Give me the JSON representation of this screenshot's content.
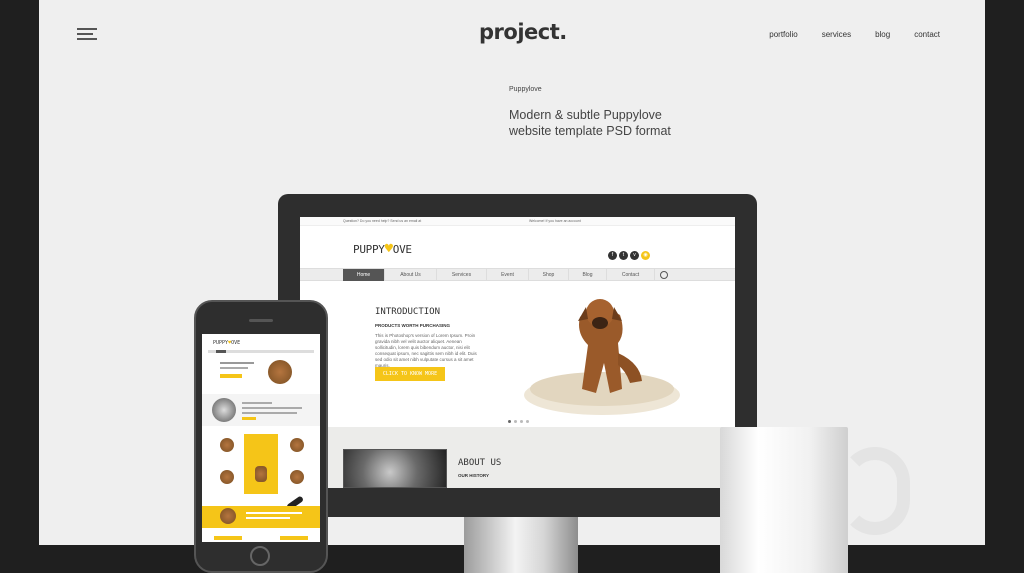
{
  "header": {
    "logo": "project.",
    "nav": [
      "portfolio",
      "services",
      "blog",
      "contact"
    ]
  },
  "project": {
    "tag": "Puppylove",
    "title": "Modern & subtle Puppylove website template PSD format"
  },
  "desktop_site": {
    "top_left_text": "Question? Do you need help? Send us an email at",
    "top_right_text": "Welcome! If you have an account",
    "logo_left": "PUPPY",
    "logo_right": "OVE",
    "social": [
      "f",
      "t",
      "v",
      "rss"
    ],
    "nav": [
      "Home",
      "About Us",
      "Services",
      "Event",
      "Shop",
      "Blog",
      "Contact"
    ],
    "hero": {
      "title": "INTRODUCTION",
      "subtitle": "PRODUCTS WORTH PURCHASING",
      "body": "This is Photoshop's version of Lorem Ipsum. Proin gravida nibh vel velit auctor aliquet. Aenean sollicitudin, lorem quis bibendum auctor, nisi elit consequat ipsum, nec sagittis sem nibh id elit. Duis sed odio sit amet nibh vulputate cursus a sit amet mauris.",
      "cta": "CLICK TO KNOW MORE"
    },
    "about": {
      "title": "ABOUT US",
      "subtitle": "OUR HISTORY"
    }
  },
  "mobile_site": {
    "logo_left": "PUPPY",
    "logo_right": "OVE"
  },
  "colors": {
    "accent": "#f5c518",
    "dark": "#2e2e2e",
    "page_bg": "#efefef"
  }
}
